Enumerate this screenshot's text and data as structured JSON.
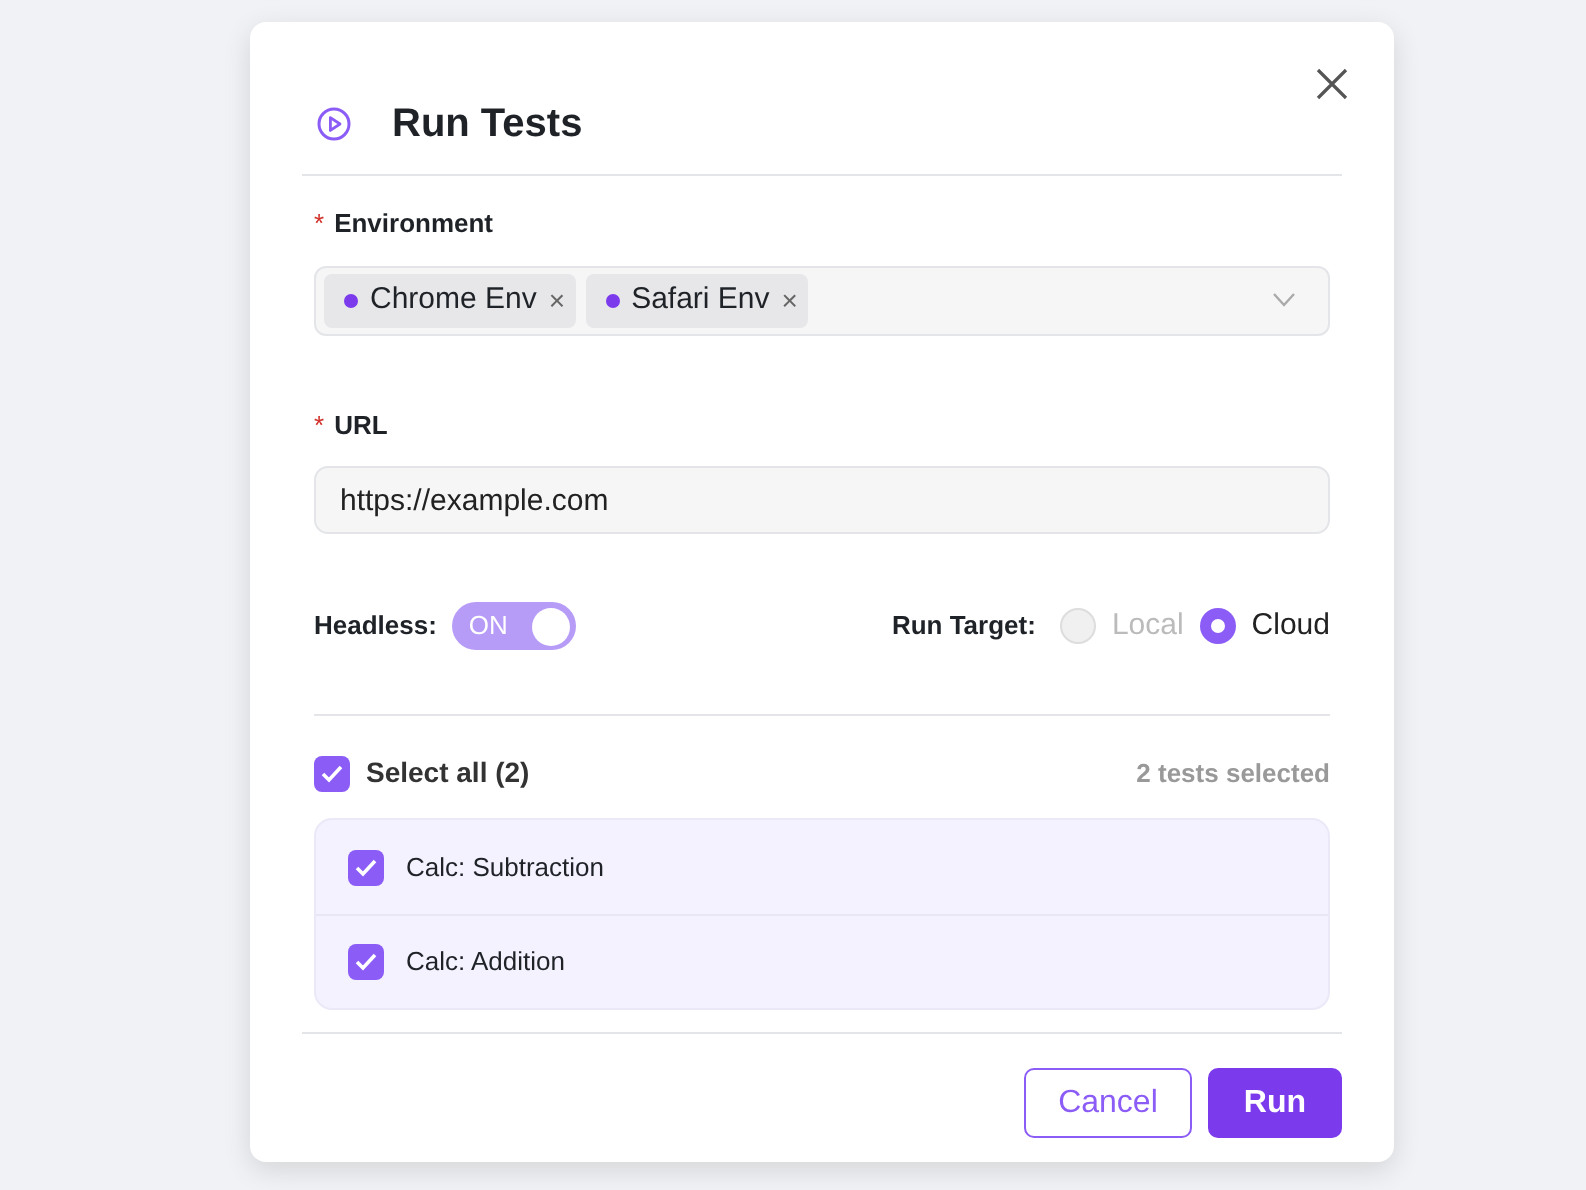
{
  "dialog": {
    "title": "Run Tests"
  },
  "environment": {
    "required_mark": "*",
    "label": "Environment",
    "tags": [
      {
        "label": "Chrome Env",
        "color": "#7c3aed",
        "remove": "×"
      },
      {
        "label": "Safari Env",
        "color": "#7c3aed",
        "remove": "×"
      }
    ]
  },
  "url": {
    "required_mark": "*",
    "label": "URL",
    "value": "https://example.com"
  },
  "headless": {
    "label": "Headless:",
    "on": true,
    "state_text": "ON"
  },
  "run_target": {
    "label": "Run Target:",
    "options": [
      {
        "label": "Local",
        "selected": false,
        "disabled": true
      },
      {
        "label": "Cloud",
        "selected": true,
        "disabled": false
      }
    ]
  },
  "select_all": {
    "label": "Select all (2)",
    "checked": true
  },
  "selection_count": "2 tests selected",
  "tests": [
    {
      "label": "Calc: Subtraction",
      "checked": true
    },
    {
      "label": "Calc: Addition",
      "checked": true
    }
  ],
  "buttons": [
    {
      "label": "Cancel",
      "kind": "secondary"
    },
    {
      "label": "Run",
      "kind": "primary"
    }
  ]
}
